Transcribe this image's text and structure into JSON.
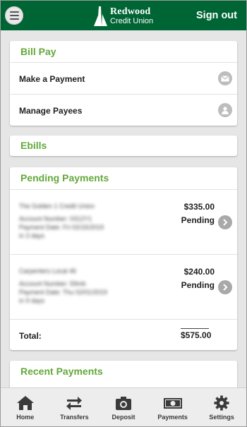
{
  "header": {
    "brand_line1": "Redwood",
    "brand_line2": "Credit Union",
    "signout_label": "Sign out"
  },
  "bill_pay": {
    "title": "Bill Pay",
    "items": [
      {
        "label": "Make a Payment",
        "icon": "envelope-icon"
      },
      {
        "label": "Manage Payees",
        "icon": "user-icon"
      }
    ]
  },
  "ebills": {
    "title": "Ebills"
  },
  "pending_payments": {
    "title": "Pending Payments",
    "items": [
      {
        "payee": "The Golden 1 Credit Union",
        "account_line": "Account Number: 0312Y1",
        "date_line": "Payment Date: Fri 02/15/2019",
        "days_line": "in 3 days",
        "amount": "$335.00",
        "status": "Pending"
      },
      {
        "payee": "Carpenters Local 46",
        "account_line": "Account Number: 59mb",
        "date_line": "Payment Date: Thu 02/01/2019",
        "days_line": "in 9 days",
        "amount": "$240.00",
        "status": "Pending"
      }
    ],
    "total_label": "Total:",
    "total_value": "$575.00"
  },
  "recent_payments": {
    "title": "Recent Payments"
  },
  "tabbar": {
    "items": [
      {
        "label": "Home",
        "icon": "home-icon"
      },
      {
        "label": "Transfers",
        "icon": "transfer-arrows-icon"
      },
      {
        "label": "Deposit",
        "icon": "camera-icon"
      },
      {
        "label": "Payments",
        "icon": "cash-icon"
      },
      {
        "label": "Settings",
        "icon": "gear-icon"
      }
    ]
  },
  "colors": {
    "brand_green": "#006534",
    "section_title_green": "#63a83a",
    "background": "#e6e6e6"
  }
}
